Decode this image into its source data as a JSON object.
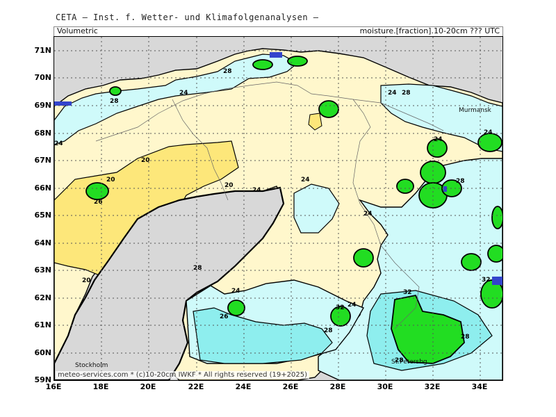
{
  "title": "CETA — Inst. f. Wetter- und Klimafolgenanalysen —",
  "header": {
    "left": "Volumetric",
    "right": "moisture.[fraction].10-20cm ??? UTC"
  },
  "credit": "meteo-services.com * (c)10-20cm IWKF * All rights reserved (19+2025)",
  "axes": {
    "lat_labels": [
      "71N",
      "70N",
      "69N",
      "68N",
      "67N",
      "66N",
      "65N",
      "64N",
      "63N",
      "62N",
      "61N",
      "60N",
      "59N"
    ],
    "lon_labels": [
      "16E",
      "18E",
      "20E",
      "22E",
      "24E",
      "26E",
      "28E",
      "30E",
      "32E",
      "34E"
    ]
  },
  "cities": {
    "murmansk": "Murmansk",
    "stockholm": "Stockholm",
    "stpetersburg": "St.Petersbg."
  },
  "contour_labels": {
    "c20_a": "20",
    "c20_b": "20",
    "c20_c": "20",
    "c20_d": "20",
    "c24_a": "24",
    "c24_b": "24",
    "c24_c": "24",
    "c24_d": "24",
    "c24_e": "24",
    "c24_f": "24",
    "c24_g": "24",
    "c24_h": "24",
    "c24_i": "24",
    "c24_j": "24",
    "c28_a": "28",
    "c28_b": "28",
    "c28_c": "28",
    "c28_d": "28",
    "c28_e": "28",
    "c28_f": "28",
    "c28_g": "28",
    "c28_h": "28",
    "c32_a": "32",
    "c32_b": "32",
    "c32_c": "32",
    "c26_a": "26",
    "c26_b": "26"
  },
  "colors": {
    "sea": "#d8d8d8",
    "band_16_20": "#fde77a",
    "band_20_24": "#fff7cc",
    "band_24_28": "#cffafa",
    "band_28_32": "#8eeeee",
    "band_32_plus": "#22dd22",
    "water_blue": "#3344cc"
  }
}
